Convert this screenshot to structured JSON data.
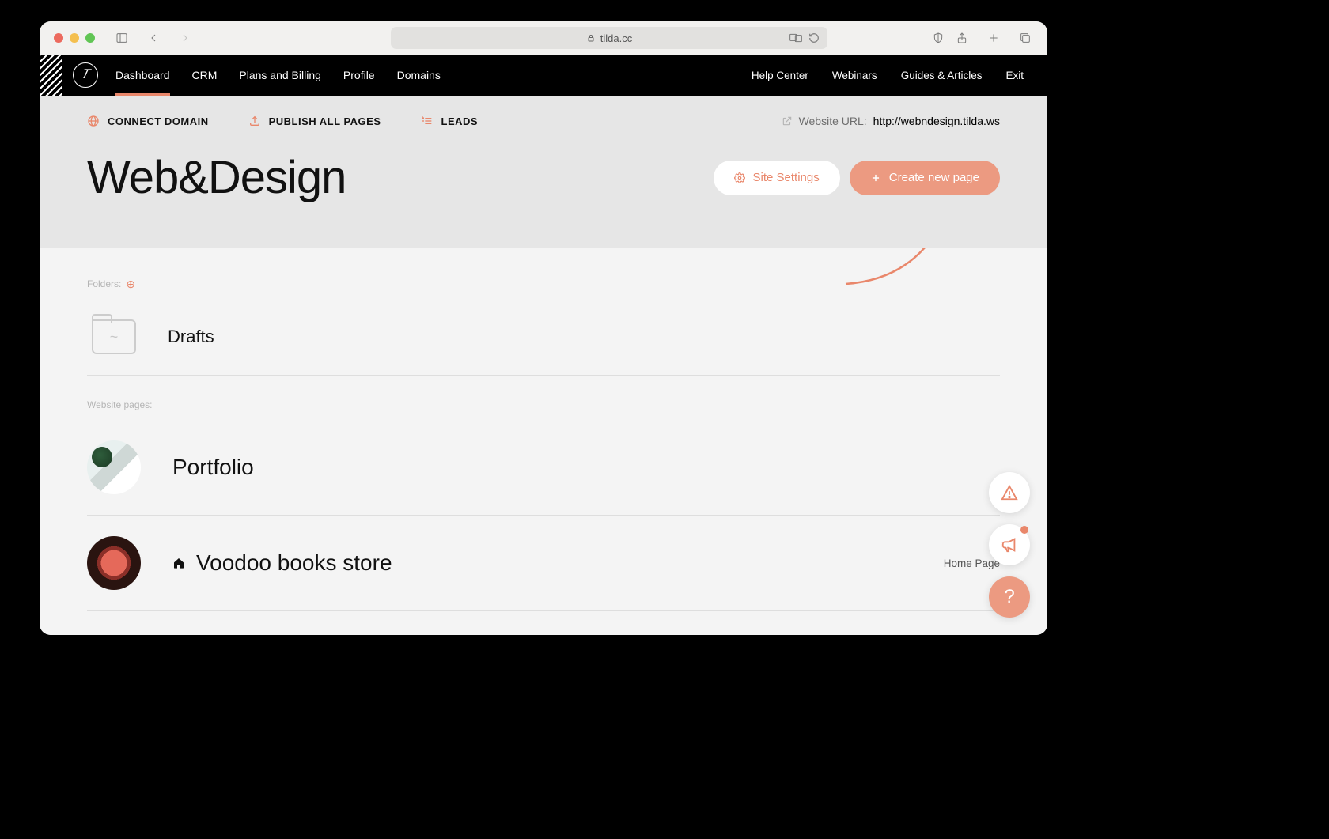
{
  "browser": {
    "url_host": "tilda.cc"
  },
  "topnav": {
    "left": [
      "Dashboard",
      "CRM",
      "Plans and Billing",
      "Profile",
      "Domains"
    ],
    "active_index": 0,
    "right": [
      "Help Center",
      "Webinars",
      "Guides & Articles",
      "Exit"
    ]
  },
  "header": {
    "actions": {
      "connect_domain": "CONNECT DOMAIN",
      "publish_all": "PUBLISH ALL PAGES",
      "leads": "LEADS"
    },
    "url_label": "Website URL:",
    "url_value": "http://webndesign.tilda.ws",
    "site_title": "Web&Design",
    "site_settings_label": "Site Settings",
    "create_page_label": "Create new page"
  },
  "content": {
    "folders_label": "Folders:",
    "pages_label": "Website pages:",
    "folders": [
      {
        "name": "Drafts"
      }
    ],
    "pages": [
      {
        "name": "Portfolio",
        "is_home": false,
        "right": ""
      },
      {
        "name": "Voodoo books store",
        "is_home": true,
        "right": "Home Page"
      }
    ]
  },
  "fab": {
    "help_symbol": "?"
  }
}
